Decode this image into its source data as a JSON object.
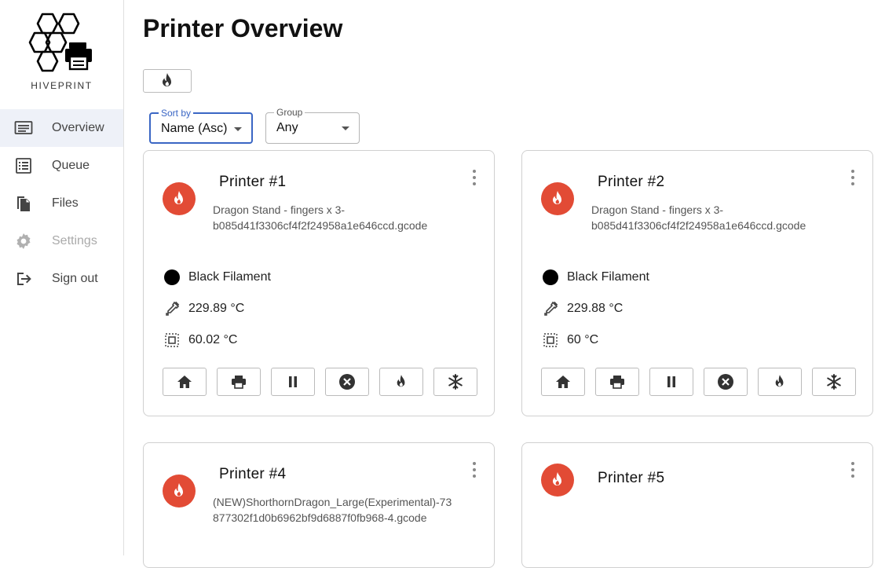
{
  "brand": {
    "name": "HIVEPRINT"
  },
  "sidebar": {
    "items": [
      {
        "label": "Overview",
        "icon": "monitor-list-icon",
        "active": true
      },
      {
        "label": "Queue",
        "icon": "queue-list-icon"
      },
      {
        "label": "Files",
        "icon": "files-icon"
      },
      {
        "label": "Settings",
        "icon": "gear-icon",
        "disabled": true
      },
      {
        "label": "Sign out",
        "icon": "sign-out-icon"
      }
    ]
  },
  "page": {
    "title": "Printer Overview"
  },
  "toolbar": {
    "preheat_icon": "flame-icon"
  },
  "filters": {
    "sort": {
      "label": "Sort by",
      "value": "Name (Asc)"
    },
    "group": {
      "label": "Group",
      "value": "Any"
    }
  },
  "colors": {
    "accent": "#3a66c4",
    "status_red": "#e24b35"
  },
  "printers": [
    {
      "name": "Printer #1",
      "file": "Dragon Stand - fingers x 3-b085d41f3306cf4f2f24958a1e646ccd.gcode",
      "filament": "Black Filament",
      "nozzle_temp": "229.89 °C",
      "bed_temp": "60.02 °C"
    },
    {
      "name": "Printer #2",
      "file": "Dragon Stand - fingers x 3-b085d41f3306cf4f2f24958a1e646ccd.gcode",
      "filament": "Black Filament",
      "nozzle_temp": "229.88 °C",
      "bed_temp": "60 °C"
    },
    {
      "name": "Printer #4",
      "file": "(NEW)ShorthornDragon_Large(Experimental)-73877302f1d0b6962bf9d6887f0fb968-4.gcode"
    },
    {
      "name": "Printer #5",
      "file": ""
    }
  ],
  "card_actions": [
    "home-icon",
    "print-icon",
    "pause-icon",
    "cancel-icon",
    "flame-icon",
    "snowflake-icon"
  ]
}
